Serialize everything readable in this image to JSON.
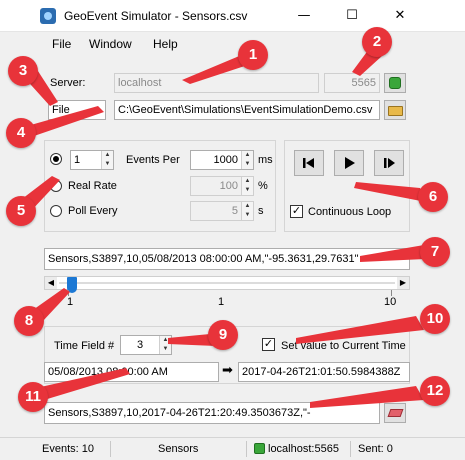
{
  "window": {
    "title": "GeoEvent Simulator - Sensors.csv",
    "minimize_glyph": "—",
    "maximize_glyph": "☐",
    "close_glyph": "✕"
  },
  "menu": {
    "items": [
      "File",
      "Window",
      "Help"
    ]
  },
  "server": {
    "label": "Server:",
    "host_placeholder": "localhost",
    "port_placeholder": "5565",
    "connect_icon": "connect-icon"
  },
  "source": {
    "selected": "File",
    "path": "C:\\GeoEvent\\Simulations\\EventSimulationDemo.csv",
    "browse_icon": "folder-icon"
  },
  "rate": {
    "events_per_count": "1",
    "events_per_label": "Events Per",
    "events_per_ms": "1000",
    "ms_unit": "ms",
    "real_rate_label": "Real Rate",
    "real_rate_value": "100",
    "percent_unit": "%",
    "poll_every_label": "Poll Every",
    "poll_every_value": "5",
    "seconds_unit": "s",
    "selected": "events_per"
  },
  "playback": {
    "continuous_loop_label": "Continuous Loop",
    "continuous_loop_checked": true
  },
  "current_event": "Sensors,S3897,10,05/08/2013 08:00:00 AM,\"-95.3631,29.7631\"",
  "slider": {
    "min_label": "1",
    "current_label": "1",
    "max_label": "10",
    "value": 1,
    "min": 1,
    "max": 10
  },
  "time_field": {
    "label": "Time Field #",
    "value": "3",
    "set_current_label": "Set value to Current Time",
    "set_current_checked": true,
    "original_time": "05/08/2013 08:00:00 AM",
    "arrow": "➡",
    "new_time": "2017-04-26T21:01:50.5984388Z"
  },
  "output_event": "Sensors,S3897,10,2017-04-26T21:20:49.3503673Z,\"-",
  "status": {
    "events": "Events: 10",
    "layer": "Sensors",
    "connection": "localhost:5565",
    "sent": "Sent: 0"
  },
  "callouts": [
    "1",
    "2",
    "3",
    "4",
    "5",
    "6",
    "7",
    "8",
    "9",
    "10",
    "11",
    "12"
  ],
  "colors": {
    "callout": "#e8333a",
    "slider_thumb": "#1c78d4",
    "connect_green": "#3aa63a"
  }
}
